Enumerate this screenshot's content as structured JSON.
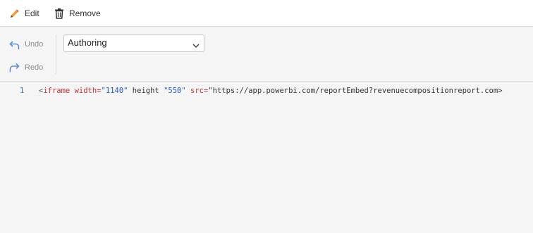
{
  "toolbar_top": {
    "edit_label": "Edit",
    "remove_label": "Remove"
  },
  "history": {
    "undo_label": "Undo",
    "redo_label": "Redo"
  },
  "mode_select": {
    "value": "Authoring"
  },
  "editor": {
    "line_number": "1",
    "code": {
      "open_bracket": "<",
      "tag": "iframe",
      "attr_width": "width=",
      "val_width": "\"1140\"",
      "attr_height": "height",
      "val_height": "\"550\"",
      "attr_src": "src=",
      "val_src": "\"https://app.powerbi.com/reportEmbed?revenuecompositionreport.com>"
    }
  },
  "icons": {
    "edit": "pencil-icon",
    "remove": "trash-icon",
    "undo": "undo-icon",
    "redo": "redo-icon",
    "dropdown": "chevron-down-icon"
  },
  "colors": {
    "pencil": "#f0a030",
    "accent_blue": "#2f6ecf",
    "keyword_red": "#c03030",
    "string_blue": "#2258c9"
  }
}
